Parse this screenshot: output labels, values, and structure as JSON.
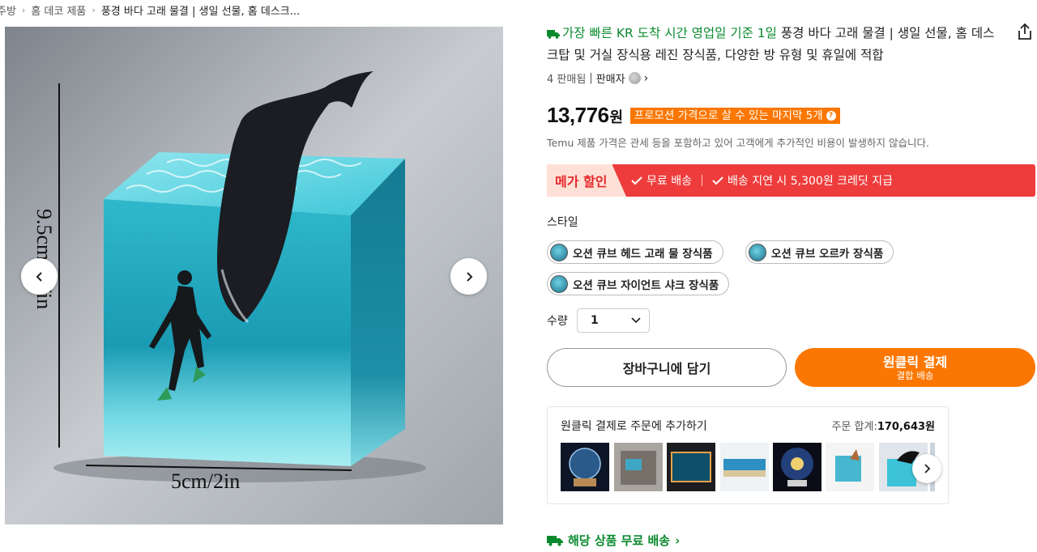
{
  "breadcrumb": {
    "items": [
      "주방",
      "홈 데코 제품"
    ],
    "current": "풍경 바다 고래 물결 | 생일 선물, 홈 데스크..."
  },
  "product": {
    "fast_delivery": "가장 빠른 KR 도착 시간 영업일 기준 1일",
    "title": "풍경 바다 고래 물결 | 생일 선물, 홈 데스크탑 및 거실 장식용 레진 장식품, 다양한 방 유형 및 휴일에 적합",
    "sold": "4 판매됨",
    "seller_label": "판매자",
    "price": "13,776",
    "currency": "원",
    "promo": "프로모션 가격으로 살 수 있는 마지막 5개",
    "tax_note": "Temu 제품 가격은 관세 등을 포함하고 있어 고객에게 추가적인 비용이 발생하지 않습니다."
  },
  "mega": {
    "badge": "메가 할인",
    "perk1": "무료 배송",
    "perk2": "배송 지연 시 5,300원 크레딧 지급"
  },
  "style": {
    "label": "스타일",
    "options": [
      "오션 큐브 헤드 고래 물 장식품",
      "오션 큐브 오르카 장식품",
      "오션 큐브 자이언트 샤크 장식품"
    ]
  },
  "quantity": {
    "label": "수량",
    "value": "1"
  },
  "actions": {
    "cart": "장바구니에 담기",
    "buy": "원클릭 결제",
    "buy_sub": "결합 배송"
  },
  "bundle": {
    "title": "원클릭 결제로 주문에 추가하기",
    "total_label": "주문 합계:",
    "total_value": "170,643원"
  },
  "shipping": {
    "free": "해당 상품 무료 배송"
  },
  "gallery": {
    "height_label": "9.5cm/3.7in",
    "width_label": "5cm/2in"
  },
  "colors": {
    "accent": "#fb7701",
    "green": "#0a8a2e",
    "mega_red": "#ee3c3c"
  },
  "icons": {
    "prev": "chevron-left-icon",
    "next": "chevron-right-icon",
    "share": "share-icon",
    "truck": "truck-icon",
    "check": "check-icon"
  }
}
